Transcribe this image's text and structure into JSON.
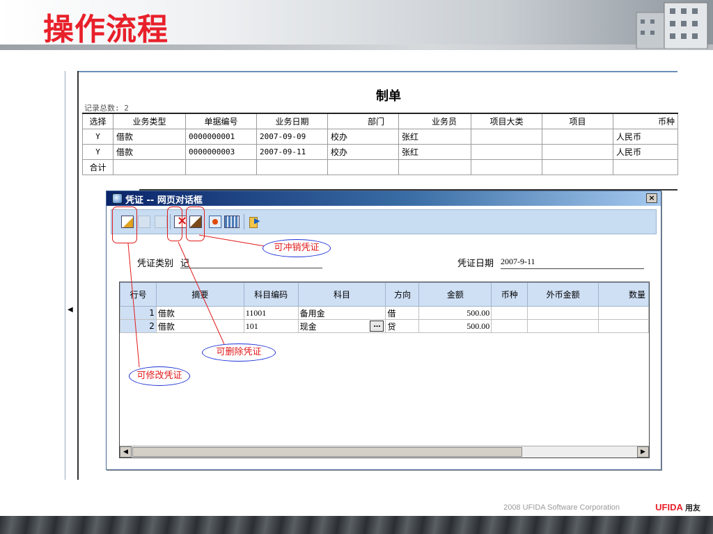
{
  "slide": {
    "title": "操作流程",
    "footer_text": "2008 UFIDA Software Corporation",
    "footer_brand": "UFIDA",
    "footer_brand_cn": "用友"
  },
  "page": {
    "title": "制单",
    "record_count": "记录总数: 2"
  },
  "grid": {
    "columns": [
      "选择",
      "业务类型",
      "单据编号",
      "业务日期",
      "部门",
      "业务员",
      "项目大类",
      "项目",
      "币种"
    ],
    "rows": [
      [
        "Y",
        "借款",
        "0000000001",
        "2007-09-09",
        "校办",
        "张红",
        "",
        "",
        "人民币"
      ],
      [
        "Y",
        "借款",
        "0000000003",
        "2007-09-11",
        "校办",
        "张红",
        "",
        "",
        "人民币"
      ],
      [
        "合计",
        "",
        "",
        "",
        "",
        "",
        "",
        "",
        ""
      ]
    ]
  },
  "dialog": {
    "title": "凭证 -- 网页对话框",
    "close_label": "×",
    "voucher_type_label": "凭证类别",
    "voucher_type_value": "记",
    "voucher_date_label": "凭证日期",
    "voucher_date_value": "2007-9-11",
    "toolbar": [
      "edit-voucher",
      "undo",
      "save",
      "delete-voucher",
      "reverse-voucher",
      "print",
      "grid-settings",
      "exit"
    ],
    "columns": [
      "行号",
      "摘要",
      "科目编码",
      "科目",
      "方向",
      "金额",
      "币种",
      "外币金额",
      "数量"
    ],
    "rows": [
      [
        "1",
        "借款",
        "11001",
        "备用金",
        "借",
        "500.00",
        "",
        "",
        ""
      ],
      [
        "2",
        "借款",
        "101",
        "现金",
        "贷",
        "500.00",
        "",
        "",
        ""
      ]
    ],
    "ellipsis": "…"
  },
  "annotations": {
    "reverse": "可冲销凭证",
    "delete": "可删除凭证",
    "edit": "可修改凭证"
  },
  "colors": {
    "title_red": "#e8202a",
    "dialog_titlebar": "#0a246a",
    "annotation_red": "#e11a1a",
    "annotation_blue": "#1d2fd6"
  }
}
